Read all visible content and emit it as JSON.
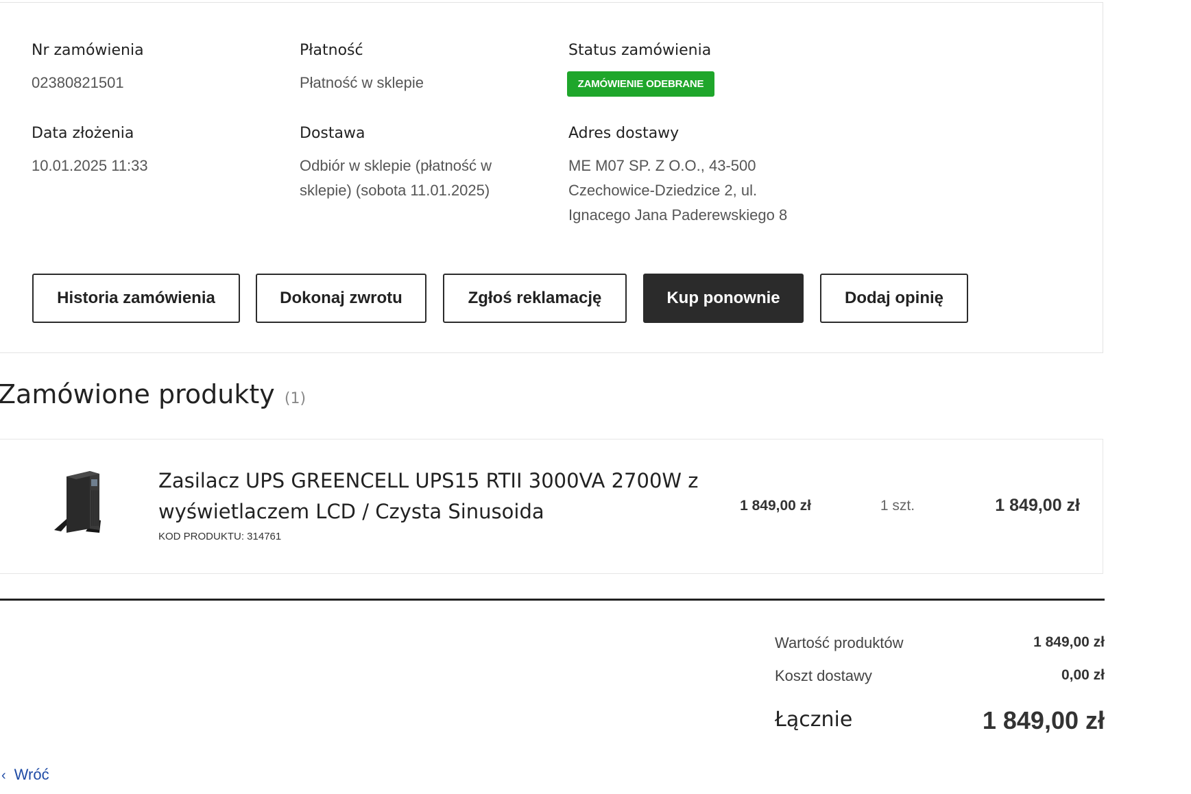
{
  "order_info": {
    "order_number_label": "Nr zamówienia",
    "order_number": "02380821501",
    "payment_label": "Płatność",
    "payment": "Płatność w sklepie",
    "status_label": "Status zamówienia",
    "status": "ZAMÓWIENIE ODEBRANE",
    "status_color": "#1fa62b",
    "date_label": "Data złożenia",
    "date": "10.01.2025 11:33",
    "delivery_label": "Dostawa",
    "delivery_line1": "Odbiór w sklepie (płatność w",
    "delivery_line2": "sklepie) (sobota 11.01.2025)",
    "address_label": "Adres dostawy",
    "address_line1": "ME M07 SP. Z O.O., 43-500",
    "address_line2": "Czechowice-Dziedzice 2, ul.",
    "address_line3": "Ignacego Jana Paderewskiego 8"
  },
  "actions": {
    "history": "Historia zamówienia",
    "return": "Dokonaj zwrotu",
    "complaint": "Zgłoś reklamację",
    "buy_again": "Kup ponownie",
    "review": "Dodaj opinię"
  },
  "products": {
    "heading": "Zamówione produkty",
    "count": "(1)",
    "items": [
      {
        "name_line1": "Zasilacz UPS GREENCELL UPS15 RTII 3000VA 2700W z",
        "name_line2": "wyświetlaczem LCD / Czysta Sinusoida",
        "code": "KOD PRODUKTU: 314761",
        "unit_price": "1 849,00 zł",
        "quantity": "1 szt.",
        "total": "1 849,00 zł",
        "image_icon": "ups-tower-icon"
      }
    ]
  },
  "summary": {
    "products_value_label": "Wartość produktów",
    "products_value": "1 849,00 zł",
    "shipping_label": "Koszt dostawy",
    "shipping": "0,00 zł",
    "total_label": "Łącznie",
    "total": "1 849,00 zł"
  },
  "nav": {
    "back_label": "Wróć",
    "back_icon": "chevron-left-icon",
    "link_color": "#1f4ba5"
  }
}
